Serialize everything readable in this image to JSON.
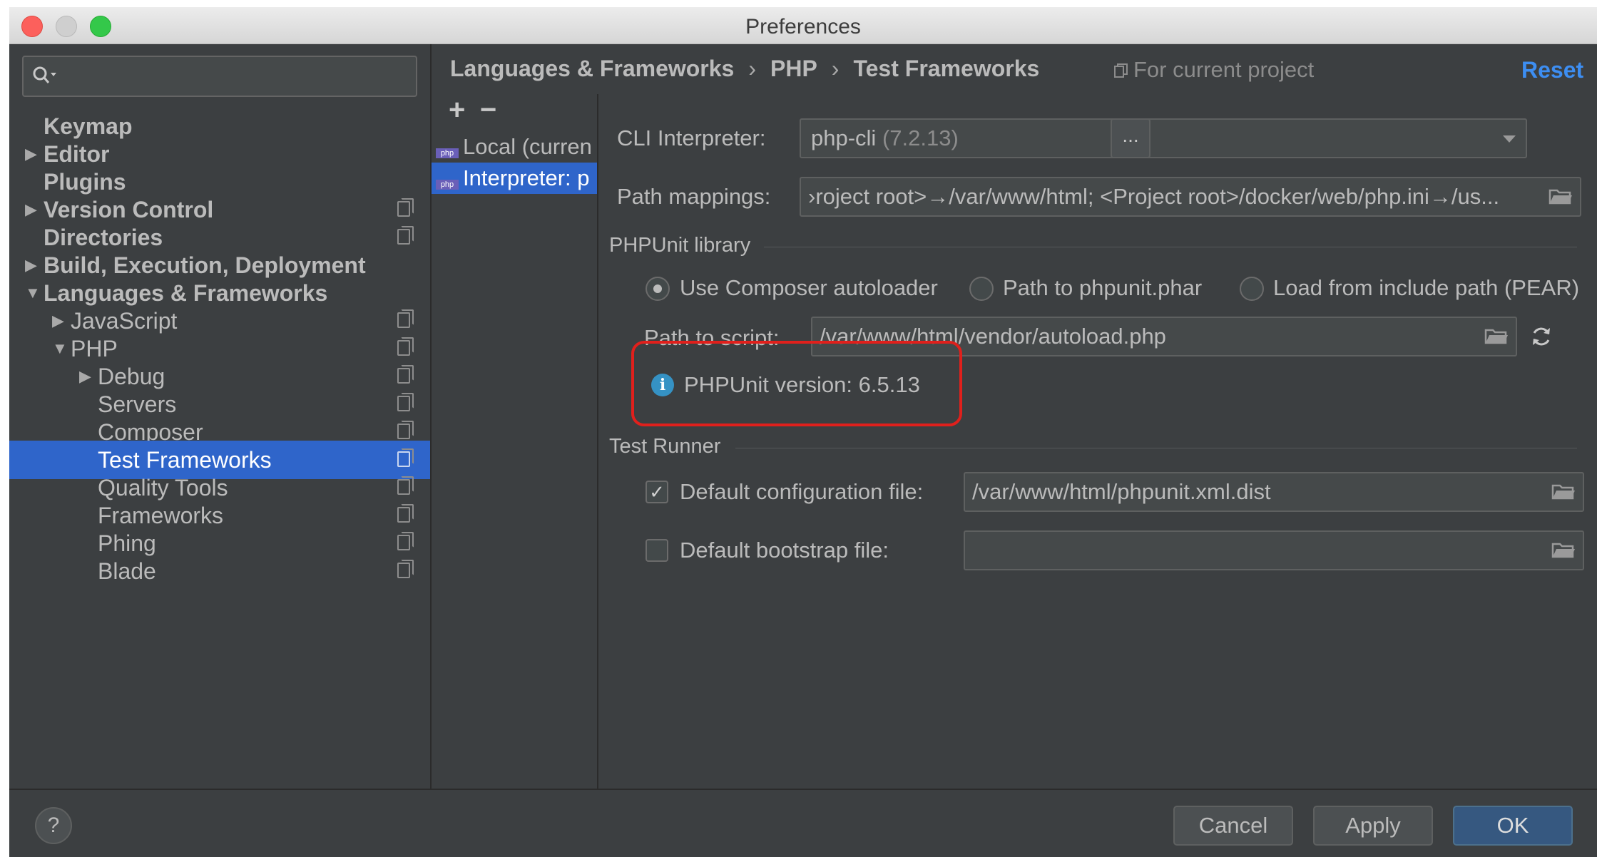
{
  "window": {
    "title": "Preferences"
  },
  "search": {
    "placeholder": ""
  },
  "sidebar": {
    "items": [
      {
        "label": "Keymap"
      },
      {
        "label": "Editor"
      },
      {
        "label": "Plugins"
      },
      {
        "label": "Version Control"
      },
      {
        "label": "Directories"
      },
      {
        "label": "Build, Execution, Deployment"
      },
      {
        "label": "Languages & Frameworks"
      },
      {
        "label": "JavaScript"
      },
      {
        "label": "PHP"
      },
      {
        "label": "Debug"
      },
      {
        "label": "Servers"
      },
      {
        "label": "Composer"
      },
      {
        "label": "Test Frameworks"
      },
      {
        "label": "Quality Tools"
      },
      {
        "label": "Frameworks"
      },
      {
        "label": "Phing"
      },
      {
        "label": "Blade"
      }
    ]
  },
  "breadcrumb": {
    "part1": "Languages & Frameworks",
    "part2": "PHP",
    "part3": "Test Frameworks",
    "separator": "›"
  },
  "scope": {
    "label": "For current project"
  },
  "reset_label": "Reset",
  "interpreters": {
    "add": "+",
    "remove": "−",
    "items": [
      {
        "label": "Local (curren",
        "icon_text": "php"
      },
      {
        "label": "Interpreter: p",
        "icon_text": "php"
      }
    ]
  },
  "cli": {
    "label": "CLI Interpreter:",
    "value": "php-cli",
    "version": "(7.2.13)",
    "more": "..."
  },
  "mappings": {
    "label": "Path mappings:",
    "value": "›roject root>→/var/www/html; <Project root>/docker/web/php.ini→/us..."
  },
  "phpunit": {
    "section": "PHPUnit library",
    "options": [
      "Use Composer autoloader",
      "Path to phpunit.phar",
      "Load from include path (PEAR)"
    ],
    "selected": "Use Composer autoloader",
    "script_label": "Path to script:",
    "script_value": "/var/www/html/vendor/autoload.php",
    "version_text": "PHPUnit version: 6.5.13"
  },
  "runner": {
    "section": "Test Runner",
    "config_label": "Default configuration file:",
    "config_checked": true,
    "config_value": "/var/www/html/phpunit.xml.dist",
    "bootstrap_label": "Default bootstrap file:",
    "bootstrap_checked": false,
    "bootstrap_value": ""
  },
  "footer": {
    "help": "?",
    "cancel": "Cancel",
    "apply": "Apply",
    "ok": "OK"
  },
  "colors": {
    "accent": "#2f65ca",
    "link": "#3d8ef2",
    "highlight": "#e0201c",
    "background": "#3c3f41"
  }
}
